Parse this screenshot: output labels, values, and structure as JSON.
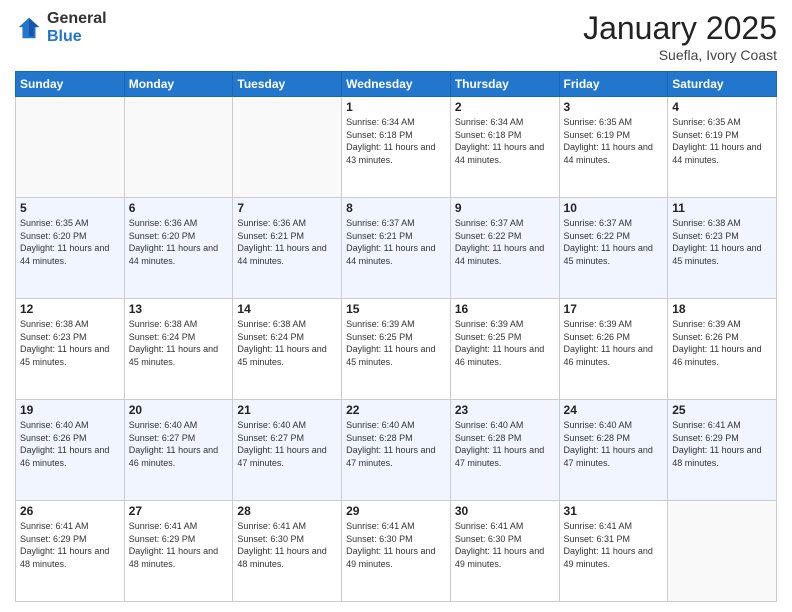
{
  "logo": {
    "general": "General",
    "blue": "Blue"
  },
  "header": {
    "month": "January 2025",
    "location": "Suefla, Ivory Coast"
  },
  "weekdays": [
    "Sunday",
    "Monday",
    "Tuesday",
    "Wednesday",
    "Thursday",
    "Friday",
    "Saturday"
  ],
  "weeks": [
    [
      {
        "day": "",
        "sunrise": "",
        "sunset": "",
        "daylight": ""
      },
      {
        "day": "",
        "sunrise": "",
        "sunset": "",
        "daylight": ""
      },
      {
        "day": "",
        "sunrise": "",
        "sunset": "",
        "daylight": ""
      },
      {
        "day": "1",
        "sunrise": "Sunrise: 6:34 AM",
        "sunset": "Sunset: 6:18 PM",
        "daylight": "Daylight: 11 hours and 43 minutes."
      },
      {
        "day": "2",
        "sunrise": "Sunrise: 6:34 AM",
        "sunset": "Sunset: 6:18 PM",
        "daylight": "Daylight: 11 hours and 44 minutes."
      },
      {
        "day": "3",
        "sunrise": "Sunrise: 6:35 AM",
        "sunset": "Sunset: 6:19 PM",
        "daylight": "Daylight: 11 hours and 44 minutes."
      },
      {
        "day": "4",
        "sunrise": "Sunrise: 6:35 AM",
        "sunset": "Sunset: 6:19 PM",
        "daylight": "Daylight: 11 hours and 44 minutes."
      }
    ],
    [
      {
        "day": "5",
        "sunrise": "Sunrise: 6:35 AM",
        "sunset": "Sunset: 6:20 PM",
        "daylight": "Daylight: 11 hours and 44 minutes."
      },
      {
        "day": "6",
        "sunrise": "Sunrise: 6:36 AM",
        "sunset": "Sunset: 6:20 PM",
        "daylight": "Daylight: 11 hours and 44 minutes."
      },
      {
        "day": "7",
        "sunrise": "Sunrise: 6:36 AM",
        "sunset": "Sunset: 6:21 PM",
        "daylight": "Daylight: 11 hours and 44 minutes."
      },
      {
        "day": "8",
        "sunrise": "Sunrise: 6:37 AM",
        "sunset": "Sunset: 6:21 PM",
        "daylight": "Daylight: 11 hours and 44 minutes."
      },
      {
        "day": "9",
        "sunrise": "Sunrise: 6:37 AM",
        "sunset": "Sunset: 6:22 PM",
        "daylight": "Daylight: 11 hours and 44 minutes."
      },
      {
        "day": "10",
        "sunrise": "Sunrise: 6:37 AM",
        "sunset": "Sunset: 6:22 PM",
        "daylight": "Daylight: 11 hours and 45 minutes."
      },
      {
        "day": "11",
        "sunrise": "Sunrise: 6:38 AM",
        "sunset": "Sunset: 6:23 PM",
        "daylight": "Daylight: 11 hours and 45 minutes."
      }
    ],
    [
      {
        "day": "12",
        "sunrise": "Sunrise: 6:38 AM",
        "sunset": "Sunset: 6:23 PM",
        "daylight": "Daylight: 11 hours and 45 minutes."
      },
      {
        "day": "13",
        "sunrise": "Sunrise: 6:38 AM",
        "sunset": "Sunset: 6:24 PM",
        "daylight": "Daylight: 11 hours and 45 minutes."
      },
      {
        "day": "14",
        "sunrise": "Sunrise: 6:38 AM",
        "sunset": "Sunset: 6:24 PM",
        "daylight": "Daylight: 11 hours and 45 minutes."
      },
      {
        "day": "15",
        "sunrise": "Sunrise: 6:39 AM",
        "sunset": "Sunset: 6:25 PM",
        "daylight": "Daylight: 11 hours and 45 minutes."
      },
      {
        "day": "16",
        "sunrise": "Sunrise: 6:39 AM",
        "sunset": "Sunset: 6:25 PM",
        "daylight": "Daylight: 11 hours and 46 minutes."
      },
      {
        "day": "17",
        "sunrise": "Sunrise: 6:39 AM",
        "sunset": "Sunset: 6:26 PM",
        "daylight": "Daylight: 11 hours and 46 minutes."
      },
      {
        "day": "18",
        "sunrise": "Sunrise: 6:39 AM",
        "sunset": "Sunset: 6:26 PM",
        "daylight": "Daylight: 11 hours and 46 minutes."
      }
    ],
    [
      {
        "day": "19",
        "sunrise": "Sunrise: 6:40 AM",
        "sunset": "Sunset: 6:26 PM",
        "daylight": "Daylight: 11 hours and 46 minutes."
      },
      {
        "day": "20",
        "sunrise": "Sunrise: 6:40 AM",
        "sunset": "Sunset: 6:27 PM",
        "daylight": "Daylight: 11 hours and 46 minutes."
      },
      {
        "day": "21",
        "sunrise": "Sunrise: 6:40 AM",
        "sunset": "Sunset: 6:27 PM",
        "daylight": "Daylight: 11 hours and 47 minutes."
      },
      {
        "day": "22",
        "sunrise": "Sunrise: 6:40 AM",
        "sunset": "Sunset: 6:28 PM",
        "daylight": "Daylight: 11 hours and 47 minutes."
      },
      {
        "day": "23",
        "sunrise": "Sunrise: 6:40 AM",
        "sunset": "Sunset: 6:28 PM",
        "daylight": "Daylight: 11 hours and 47 minutes."
      },
      {
        "day": "24",
        "sunrise": "Sunrise: 6:40 AM",
        "sunset": "Sunset: 6:28 PM",
        "daylight": "Daylight: 11 hours and 47 minutes."
      },
      {
        "day": "25",
        "sunrise": "Sunrise: 6:41 AM",
        "sunset": "Sunset: 6:29 PM",
        "daylight": "Daylight: 11 hours and 48 minutes."
      }
    ],
    [
      {
        "day": "26",
        "sunrise": "Sunrise: 6:41 AM",
        "sunset": "Sunset: 6:29 PM",
        "daylight": "Daylight: 11 hours and 48 minutes."
      },
      {
        "day": "27",
        "sunrise": "Sunrise: 6:41 AM",
        "sunset": "Sunset: 6:29 PM",
        "daylight": "Daylight: 11 hours and 48 minutes."
      },
      {
        "day": "28",
        "sunrise": "Sunrise: 6:41 AM",
        "sunset": "Sunset: 6:30 PM",
        "daylight": "Daylight: 11 hours and 48 minutes."
      },
      {
        "day": "29",
        "sunrise": "Sunrise: 6:41 AM",
        "sunset": "Sunset: 6:30 PM",
        "daylight": "Daylight: 11 hours and 49 minutes."
      },
      {
        "day": "30",
        "sunrise": "Sunrise: 6:41 AM",
        "sunset": "Sunset: 6:30 PM",
        "daylight": "Daylight: 11 hours and 49 minutes."
      },
      {
        "day": "31",
        "sunrise": "Sunrise: 6:41 AM",
        "sunset": "Sunset: 6:31 PM",
        "daylight": "Daylight: 11 hours and 49 minutes."
      },
      {
        "day": "",
        "sunrise": "",
        "sunset": "",
        "daylight": ""
      }
    ]
  ]
}
